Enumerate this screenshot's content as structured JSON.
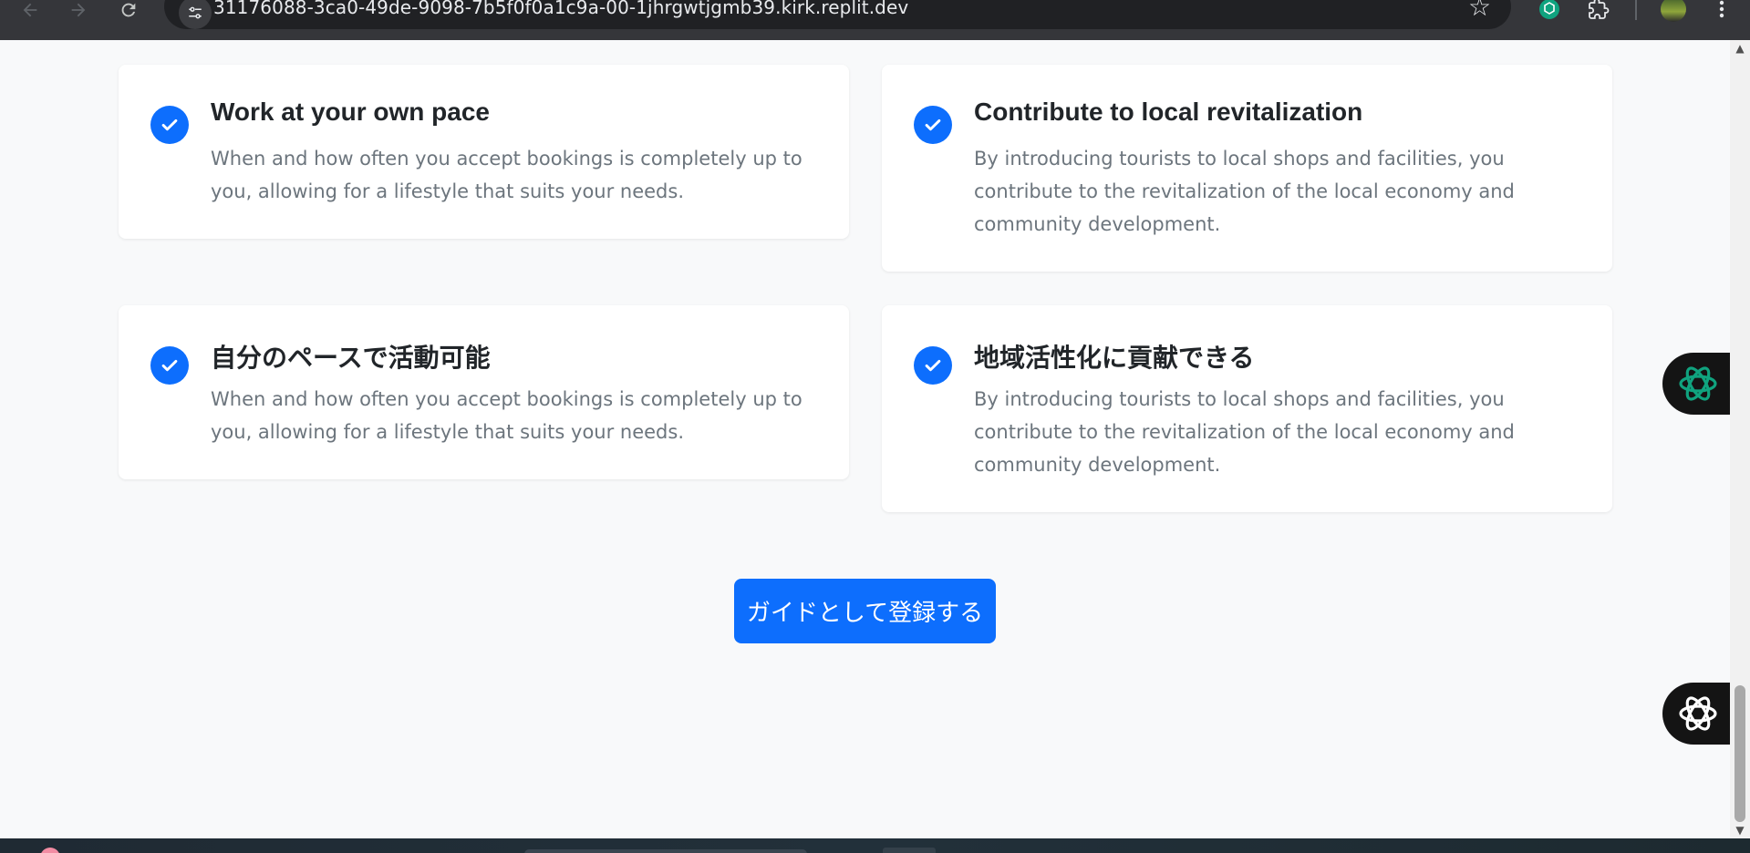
{
  "browser": {
    "url": "31176088-3ca0-49de-9098-7b5f0f0a1c9a-00-1jhrgwtjgmb39.kirk.replit.dev",
    "icons": [
      "back-arrow-icon",
      "forward-arrow-icon",
      "reload-icon",
      "site-settings-icon",
      "bookmark-star-icon",
      "chatgpt-extension-icon",
      "extensions-puzzle-icon",
      "profile-avatar-icon",
      "menu-kebab-icon"
    ]
  },
  "features": [
    {
      "title": "Work at your own pace",
      "description": "When and how often you accept bookings is completely up to you, allowing for a lifestyle that suits your needs."
    },
    {
      "title": "Contribute to local revitalization",
      "description": "By introducing tourists to local shops and facilities, you contribute to the revitalization of the local economy and community development."
    },
    {
      "title": "自分のペースで活動可能",
      "description": "When and how often you accept bookings is completely up to you, allowing for a lifestyle that suits your needs."
    },
    {
      "title": "地域活性化に貢献できる",
      "description": "By introducing tourists to local shops and facilities, you contribute to the revitalization of the local economy and community development."
    }
  ],
  "cta": {
    "register_label": "ガイドとして登録する"
  },
  "colors": {
    "primary": "#0d6efd",
    "page_bg": "#f8f9fa",
    "card_bg": "#ffffff",
    "title_text": "#212529",
    "body_text": "#6c757d",
    "widget_accent": "#10a37f"
  }
}
